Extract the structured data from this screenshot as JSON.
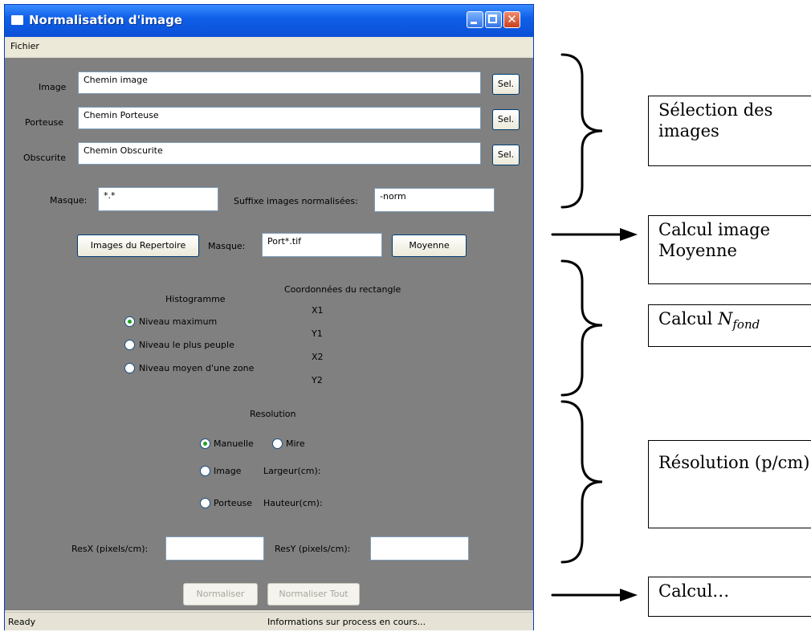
{
  "window": {
    "title": "Normalisation d'image"
  },
  "menu": {
    "file": "Fichier"
  },
  "paths": {
    "image_label": "Image",
    "image_value": "Chemin image",
    "porteuse_label": "Porteuse",
    "porteuse_value": "Chemin Porteuse",
    "obscurite_label": "Obscurite",
    "obscurite_value": "Chemin Obscurite",
    "select_label": "Sel."
  },
  "mask": {
    "label": "Masque:",
    "value": "*.*",
    "suffix_label": "Suffixe images normalisées:",
    "suffix_value": "-norm"
  },
  "directory": {
    "button": "Images du Repertoire",
    "mask_label": "Masque:",
    "mask_value": "Port*.tif",
    "average_button": "Moyenne"
  },
  "histogram": {
    "title": "Histogramme",
    "options": [
      "Niveau maximum",
      "Niveau le plus peuple",
      "Niveau moyen d'une zone"
    ],
    "selected": 0
  },
  "rectangle": {
    "title": "Coordonnées   du rectangle",
    "labels": [
      "X1",
      "Y1",
      "X2",
      "Y2"
    ]
  },
  "resolution": {
    "title": "Resolution",
    "manual": "Manuelle",
    "target": "Mire",
    "image": "Image",
    "porteuse": "Porteuse",
    "width_label": "Largeur(cm):",
    "height_label": "Hauteur(cm):",
    "resx_label": "ResX (pixels/cm):",
    "resy_label": "ResY (pixels/cm):",
    "selected": "Manuelle"
  },
  "actions": {
    "normalize": "Normaliser",
    "normalize_all": "Normaliser Tout"
  },
  "status": {
    "left": "Ready",
    "right": "Informations sur process en cours..."
  },
  "annotations": {
    "selection": "Sélection des images",
    "average": "Calcul image Moyenne",
    "background_prefix": "Calcul ",
    "background_symbol": "N",
    "background_sub": "fond",
    "resolution": "Résolution (p/cm)",
    "compute": "Calcul…"
  }
}
